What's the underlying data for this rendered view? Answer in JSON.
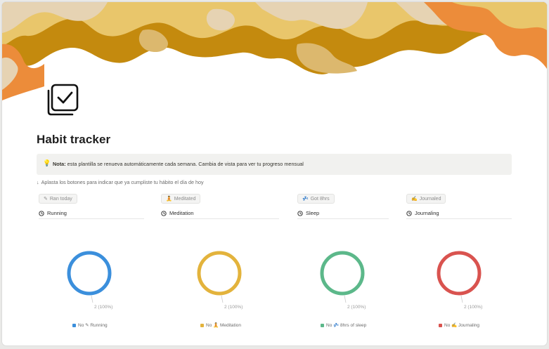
{
  "page": {
    "title": "Habit tracker"
  },
  "callout": {
    "icon": "lightbulb-icon",
    "bold": "Nota:",
    "text": " esta plantilla se renueva automáticamente cada semana. Cambia de vista para ver tu progreso mensual"
  },
  "hint": {
    "arrow": "↓",
    "text": "Aplasta los botones para indicar que ya cumpliste tu hábito el día de hoy"
  },
  "buttons": [
    {
      "icon": "✎",
      "label": "Ran today"
    },
    {
      "icon": "🧘",
      "label": "Meditated"
    },
    {
      "icon": "💤",
      "label": "Got 8hrs"
    },
    {
      "icon": "✍",
      "label": "Journaled"
    }
  ],
  "properties": [
    {
      "label": "Running"
    },
    {
      "label": "Meditation"
    },
    {
      "label": "Sleep"
    },
    {
      "label": "Journaling"
    }
  ],
  "chart_data": [
    {
      "type": "pie",
      "categories": [
        "No ✎ Running"
      ],
      "values": [
        2
      ],
      "labels": [
        "2 (100%)"
      ],
      "color": "#3b8fdc"
    },
    {
      "type": "pie",
      "categories": [
        "No 🧘 Meditation"
      ],
      "values": [
        2
      ],
      "labels": [
        "2 (100%)"
      ],
      "color": "#e3b33c"
    },
    {
      "type": "pie",
      "categories": [
        "No 💤 8hrs of sleep"
      ],
      "values": [
        2
      ],
      "labels": [
        "2 (100%)"
      ],
      "color": "#5cb88a"
    },
    {
      "type": "pie",
      "categories": [
        "No ✍ Journaling"
      ],
      "values": [
        2
      ],
      "labels": [
        "2 (100%)"
      ],
      "color": "#d9534f"
    }
  ],
  "colors": {
    "cover": [
      "#e9c66b",
      "#c48a0e",
      "#e6d3b3",
      "#ec8c3a",
      "#f0d894"
    ]
  }
}
